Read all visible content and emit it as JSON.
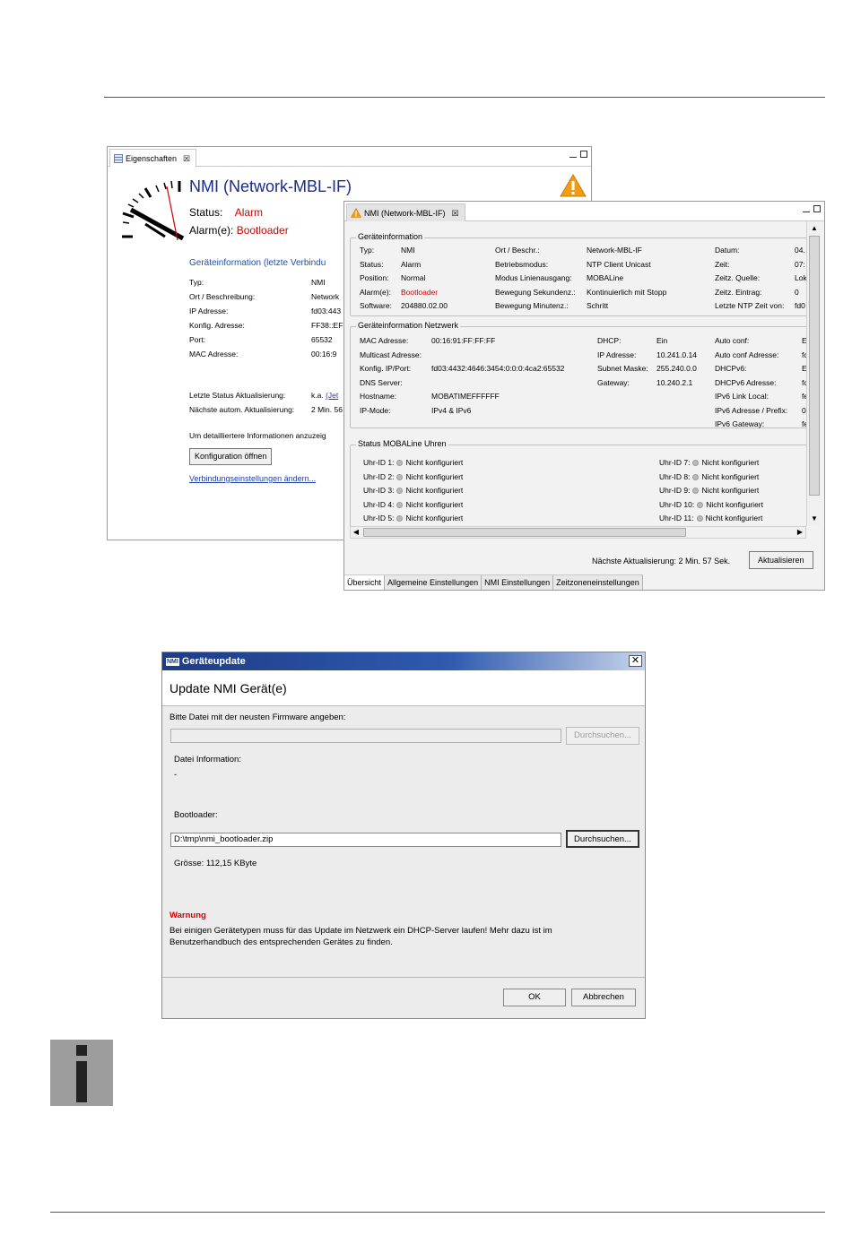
{
  "props_panel": {
    "tab_label": "Eigenschaften",
    "tab_close": "☒",
    "title": "NMI (Network-MBL-IF)",
    "status_label": "Status:",
    "status_value": "Alarm",
    "alarm_label": "Alarm(e):",
    "alarm_value": "Bootloader",
    "section_title": "Geräteinformation (letzte Verbindu",
    "rows": [
      {
        "k": "Typ:",
        "v": "NMI"
      },
      {
        "k": "Ort / Beschreibung:",
        "v": "Network"
      },
      {
        "k": "IP Adresse:",
        "v": "fd03:443"
      },
      {
        "k": "Konfig. Adresse:",
        "v": "FF38::EF"
      },
      {
        "k": "Port:",
        "v": "65532"
      },
      {
        "k": "MAC Adresse:",
        "v": "00:16:9"
      }
    ],
    "last_update_label": "Letzte Status Aktualisierung:",
    "last_update_value": "k.a.",
    "last_update_link": "(Jet",
    "next_update_label": "Nächste autom. Aktualisierung:",
    "next_update_value": "2 Min. 56",
    "details_text": "Um detailliertere Informationen anzuzeig",
    "config_button": "Konfiguration öffnen",
    "conn_link": "Verbindungseinstellungen ändern..."
  },
  "nmi_panel": {
    "tab_label": "NMI (Network-MBL-IF)",
    "tab_close": "☒",
    "group1_title": "Geräteinformation",
    "group1": [
      [
        "Typ:",
        "NMI",
        "Ort / Beschr.:",
        "Network-MBL-IF",
        "Datum:",
        "04."
      ],
      [
        "Status:",
        "Alarm",
        "Betriebsmodus:",
        "NTP Client Unicast",
        "Zeit:",
        "07:"
      ],
      [
        "Position:",
        "Normal",
        "Modus Linienausgang:",
        "MOBALine",
        "Zeitz. Quelle:",
        "Lok"
      ],
      [
        "Alarm(e):",
        "Bootloader",
        "Bewegung Sekundenz.:",
        "Kontinuierlich mit Stopp",
        "Zeitz. Eintrag:",
        "0"
      ],
      [
        "Software:",
        "204880.02.00",
        "Bewegung Minutenz.:",
        "Schritt",
        "Letzte NTP Zeit von:",
        "fd0"
      ]
    ],
    "group2_title": "Geräteinformation Netzwerk",
    "group2": [
      [
        "MAC Adresse:",
        "00:16:91:FF:FF:FF",
        "DHCP:",
        "Ein",
        "Auto conf:",
        "E"
      ],
      [
        "Multicast Adresse:",
        "",
        "IP Adresse:",
        "10.241.0.14",
        "Auto conf Adresse:",
        "fc"
      ],
      [
        "Konfig. IP/Port:",
        "fd03:4432:4646:3454:0:0:0:4ca2:65532",
        "Subnet Maske:",
        "255.240.0.0",
        "DHCPv6:",
        "E"
      ],
      [
        "DNS Server:",
        "",
        "Gateway:",
        "10.240.2.1",
        "DHCPv6 Adresse:",
        "fc"
      ],
      [
        "Hostname:",
        "MOBATIMEFFFFFF",
        "",
        "",
        "IPv6 Link Local:",
        "fe"
      ],
      [
        "IP-Mode:",
        "IPv4 & IPv6",
        "",
        "",
        "IPv6 Adresse / Prefix:",
        "0"
      ],
      [
        "",
        "",
        "",
        "",
        "IPv6 Gateway:",
        "fe"
      ]
    ],
    "group3_title": "Status MOBALine Uhren",
    "clocks_left": [
      {
        "id": "Uhr-ID 1:",
        "state": "Nicht konfiguriert"
      },
      {
        "id": "Uhr-ID 2:",
        "state": "Nicht konfiguriert"
      },
      {
        "id": "Uhr-ID 3:",
        "state": "Nicht konfiguriert"
      },
      {
        "id": "Uhr-ID 4:",
        "state": "Nicht konfiguriert"
      },
      {
        "id": "Uhr-ID 5:",
        "state": "Nicht konfiguriert"
      }
    ],
    "clocks_right": [
      {
        "id": "Uhr-ID 7:",
        "state": "Nicht konfiguriert"
      },
      {
        "id": "Uhr-ID 8:",
        "state": "Nicht konfiguriert"
      },
      {
        "id": "Uhr-ID 9:",
        "state": "Nicht konfiguriert"
      },
      {
        "id": "Uhr-ID 10:",
        "state": "Nicht konfiguriert"
      },
      {
        "id": "Uhr-ID 11:",
        "state": "Nicht konfiguriert"
      }
    ],
    "next_update": "Nächste Aktualisierung: 2 Min. 57 Sek.",
    "refresh_button": "Aktualisieren",
    "bottom_tabs": [
      "Übersicht",
      "Allgemeine Einstellungen",
      "NMI Einstellungen",
      "Zeitzoneneinstellungen"
    ]
  },
  "dialog": {
    "logo": "NMI",
    "title": "Geräteupdate",
    "close": "✕",
    "header": "Update NMI Gerät(e)",
    "firmware_label": "Bitte Datei mit der neusten Firmware angeben:",
    "firmware_value": "",
    "browse1": "Durchsuchen...",
    "file_info_label": "Datei Information:",
    "file_info_value": "-",
    "bootloader_label": "Bootloader:",
    "bootloader_value": "D:\\tmp\\nmi_bootloader.zip",
    "browse2": "Durchsuchen...",
    "size_text": "Grösse: 112,15 KByte",
    "warning_title": "Warnung",
    "warning_text": "Bei einigen Gerätetypen muss für das Update im Netzwerk ein DHCP-Server laufen! Mehr dazu ist im Benutzerhandbuch des entsprechenden Gerätes zu finden.",
    "ok": "OK",
    "cancel": "Abbrechen"
  },
  "colors": {
    "title_blue": "#1a2b8a",
    "alarm_red": "#d00000",
    "link_blue": "#1f3fa8",
    "dialog_title_bar": "#1e3c86"
  },
  "icons": [
    "properties-icon",
    "clock-icon",
    "warning-icon",
    "info-icon"
  ]
}
